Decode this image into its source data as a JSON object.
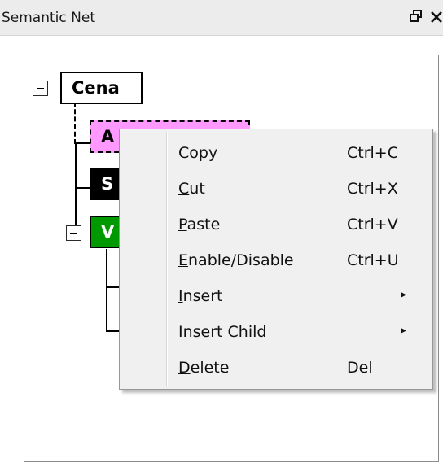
{
  "window": {
    "title": "Semantic Net",
    "restore_icon": "restore-window-icon",
    "close_icon": "close-icon"
  },
  "tree": {
    "root": {
      "label": "Cena",
      "expanded": true
    },
    "children": [
      {
        "label": "A",
        "bg": "#ff99ff",
        "fg": "#000000",
        "selected": true
      },
      {
        "label": "S",
        "bg": "#000000",
        "fg": "#ffffff"
      },
      {
        "label": "V",
        "bg": "#009900",
        "fg": "#ffffff",
        "expanded": true
      }
    ]
  },
  "context_menu": {
    "items": [
      {
        "label_hotkey": "C",
        "label_rest": "opy",
        "shortcut": "Ctrl+C"
      },
      {
        "label_hotkey": "C",
        "label_rest": "ut",
        "shortcut": "Ctrl+X"
      },
      {
        "label_hotkey": "P",
        "label_rest": "aste",
        "shortcut": "Ctrl+V"
      },
      {
        "label_hotkey": "E",
        "label_rest": "nable/Disable",
        "shortcut": "Ctrl+U"
      },
      {
        "label_hotkey": "I",
        "label_rest": "nsert",
        "submenu_arrow": "▸",
        "arrow_icon": "submenu-arrow-icon"
      },
      {
        "label_hotkey": "I",
        "label_rest": "nsert Child",
        "submenu_arrow": "▸",
        "arrow_icon": "submenu-arrow-icon"
      },
      {
        "label_hotkey": "D",
        "label_rest": "elete",
        "shortcut": "Del"
      }
    ]
  }
}
